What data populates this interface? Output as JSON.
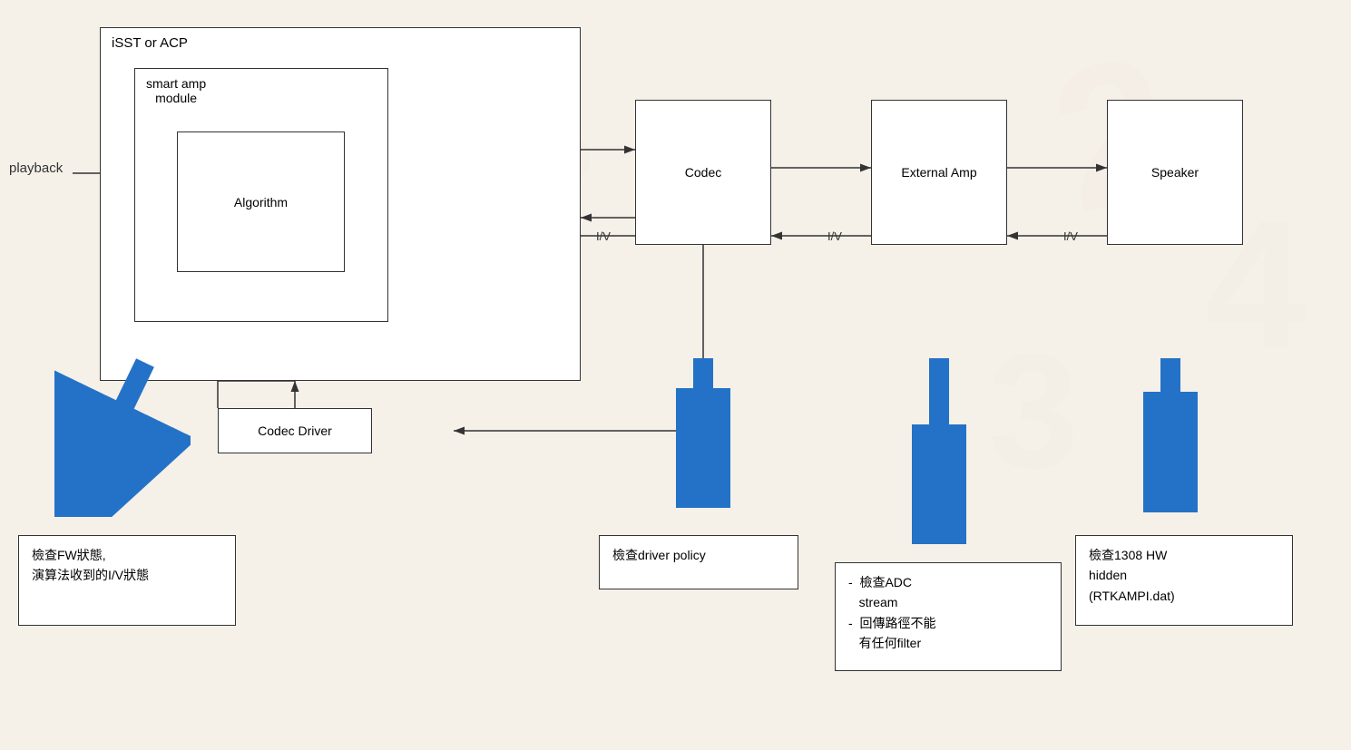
{
  "diagram": {
    "background_color": "#f5f0e8",
    "playback_label": "playback",
    "boxes": {
      "outer_big": {
        "label": "iSST or ACP",
        "label_pos": "top-left"
      },
      "smart_amp": {
        "label": "smart amp\nmodule"
      },
      "algorithm": {
        "label": "Algorithm"
      },
      "codec": {
        "label": "Codec"
      },
      "external_amp": {
        "label": "External\nAmp"
      },
      "speaker": {
        "label": "Speaker"
      },
      "codec_driver": {
        "label": "Codec Driver"
      }
    },
    "iv_labels": [
      "I/V",
      "I/V",
      "I/V"
    ],
    "info_boxes": {
      "left": {
        "lines": [
          "檢查FW狀態,",
          "演算法收到的I/V狀態"
        ]
      },
      "center": {
        "lines": [
          "檢查driver policy"
        ]
      },
      "right_mid": {
        "lines": [
          "- 檢查ADC",
          "  stream",
          "- 回傳路徑不能",
          "  有任何filter"
        ]
      },
      "right": {
        "lines": [
          "檢查1308 HW",
          "hidden",
          "(RTKAMPI.dat)"
        ]
      }
    }
  }
}
